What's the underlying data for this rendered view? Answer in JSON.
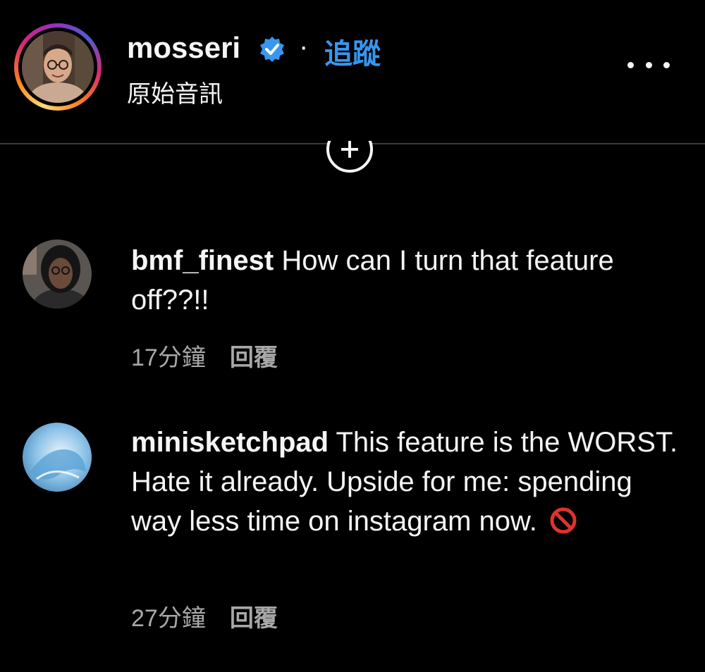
{
  "header": {
    "username": "mosseri",
    "separator": "·",
    "follow_label": "追蹤",
    "audio_label": "原始音訊",
    "verified_icon": "verified-badge-icon",
    "more_icon": "more-options-icon",
    "colors": {
      "follow": "#3797f0",
      "verified": "#3797f0",
      "background": "#000000"
    }
  },
  "add_icon": "add-circle-icon",
  "comments": [
    {
      "username": "bmf_finest",
      "text": "How can I turn that feature off??!!",
      "time": "17分鐘",
      "reply_label": "回覆"
    },
    {
      "username": "minisketchpad",
      "text": "This feature is the WORST. Hate it already. Upside for me: spending way less time on instagram now.",
      "emoji_icon": "no-entry-icon",
      "time": "27分鐘",
      "reply_label": "回覆"
    }
  ]
}
